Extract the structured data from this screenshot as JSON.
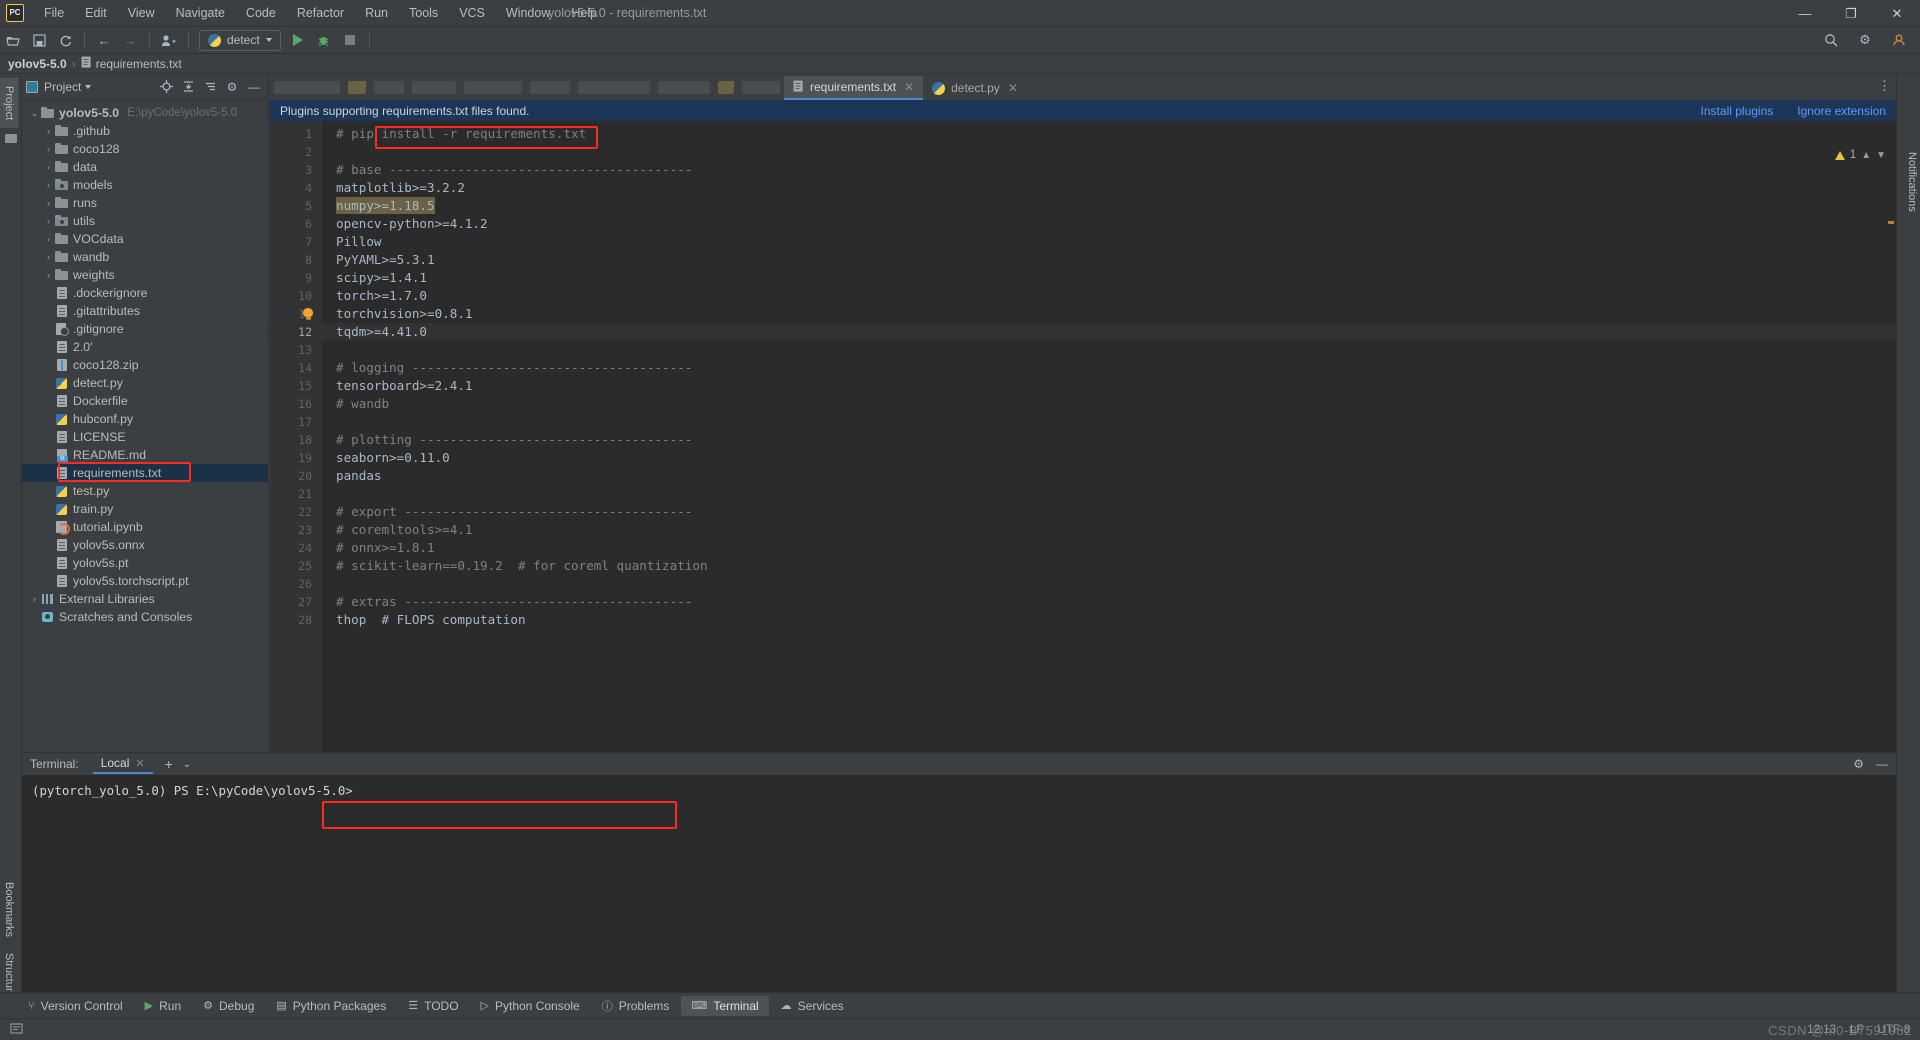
{
  "window": {
    "title": "yolov5-5.0 - requirements.txt",
    "logo": "PC",
    "minimize": "—",
    "maximize": "❐",
    "close": "✕"
  },
  "menu": [
    "File",
    "Edit",
    "View",
    "Navigate",
    "Code",
    "Refactor",
    "Run",
    "Tools",
    "VCS",
    "Window",
    "Help"
  ],
  "toolbar": {
    "open_icon": "open-folder-icon",
    "save_icon": "save-icon",
    "sync_icon": "sync-icon",
    "back_icon": "←",
    "forward_icon": "→",
    "profile_icon": "user-icon",
    "run_config": "detect",
    "run_icon": "run-icon",
    "debug_icon": "debug-icon",
    "stop_icon": "stop-icon",
    "search_icon": "⚲",
    "settings_icon": "⚙",
    "account_icon": "☲"
  },
  "breadcrumb": {
    "project": "yolov5-5.0",
    "separator": "›",
    "file": "requirements.txt"
  },
  "rails": {
    "left_top": "Project",
    "left_bottom_1": "Bookmarks",
    "left_bottom_2": "Structure",
    "right": "Notifications"
  },
  "project_panel": {
    "title": "Project",
    "icons": [
      "locate-icon",
      "collapse-all-icon",
      "expand-icon",
      "gear-icon",
      "hide-icon"
    ],
    "tree": [
      {
        "indent": 0,
        "arrow": "⌄",
        "icon": "folder",
        "name": "yolov5-5.0",
        "path": "E:\\pyCode\\yolov5-5.0",
        "bold": true
      },
      {
        "indent": 1,
        "arrow": "›",
        "icon": "folder",
        "name": ".github"
      },
      {
        "indent": 1,
        "arrow": "›",
        "icon": "folder",
        "name": "coco128"
      },
      {
        "indent": 1,
        "arrow": "›",
        "icon": "folder",
        "name": "data"
      },
      {
        "indent": 1,
        "arrow": "›",
        "icon": "folder-src",
        "name": "models"
      },
      {
        "indent": 1,
        "arrow": "›",
        "icon": "folder",
        "name": "runs"
      },
      {
        "indent": 1,
        "arrow": "›",
        "icon": "folder-src",
        "name": "utils"
      },
      {
        "indent": 1,
        "arrow": "›",
        "icon": "folder",
        "name": "VOCdata"
      },
      {
        "indent": 1,
        "arrow": "›",
        "icon": "folder",
        "name": "wandb"
      },
      {
        "indent": 1,
        "arrow": "›",
        "icon": "folder",
        "name": "weights"
      },
      {
        "indent": 1,
        "arrow": "",
        "icon": "file",
        "name": ".dockerignore"
      },
      {
        "indent": 1,
        "arrow": "",
        "icon": "file",
        "name": ".gitattributes"
      },
      {
        "indent": 1,
        "arrow": "",
        "icon": "git",
        "name": ".gitignore"
      },
      {
        "indent": 1,
        "arrow": "",
        "icon": "file",
        "name": "2.0'"
      },
      {
        "indent": 1,
        "arrow": "",
        "icon": "zip",
        "name": "coco128.zip"
      },
      {
        "indent": 1,
        "arrow": "",
        "icon": "py",
        "name": "detect.py"
      },
      {
        "indent": 1,
        "arrow": "",
        "icon": "file",
        "name": "Dockerfile"
      },
      {
        "indent": 1,
        "arrow": "",
        "icon": "py",
        "name": "hubconf.py"
      },
      {
        "indent": 1,
        "arrow": "",
        "icon": "file",
        "name": "LICENSE"
      },
      {
        "indent": 1,
        "arrow": "",
        "icon": "md",
        "name": "README.md"
      },
      {
        "indent": 1,
        "arrow": "",
        "icon": "file",
        "name": "requirements.txt",
        "selected": true,
        "annotated": true
      },
      {
        "indent": 1,
        "arrow": "",
        "icon": "py",
        "name": "test.py"
      },
      {
        "indent": 1,
        "arrow": "",
        "icon": "py",
        "name": "train.py"
      },
      {
        "indent": 1,
        "arrow": "",
        "icon": "ipynb",
        "name": "tutorial.ipynb"
      },
      {
        "indent": 1,
        "arrow": "",
        "icon": "file",
        "name": "yolov5s.onnx"
      },
      {
        "indent": 1,
        "arrow": "",
        "icon": "file",
        "name": "yolov5s.pt"
      },
      {
        "indent": 1,
        "arrow": "",
        "icon": "file",
        "name": "yolov5s.torchscript.pt"
      },
      {
        "indent": 0,
        "arrow": "›",
        "icon": "lib",
        "name": "External Libraries"
      },
      {
        "indent": 0,
        "arrow": "",
        "icon": "scratch",
        "name": "Scratches and Consoles"
      }
    ]
  },
  "editor": {
    "tabs": [
      {
        "label": "requirements.txt",
        "icon": "txt-file-icon",
        "active": true,
        "close": "✕"
      },
      {
        "label": "detect.py",
        "icon": "python-file-icon",
        "active": false,
        "close": "✕"
      }
    ],
    "notification": {
      "message": "Plugins supporting requirements.txt files found.",
      "action_install": "Install plugins",
      "action_ignore": "Ignore extension"
    },
    "warning_count": "1",
    "lines": [
      {
        "n": 1,
        "text": "# pip install -r requirements.txt",
        "type": "comment",
        "annotated": true
      },
      {
        "n": 2,
        "text": ""
      },
      {
        "n": 3,
        "text": "# base ----------------------------------------",
        "type": "comment"
      },
      {
        "n": 4,
        "text": "matplotlib>=3.2.2"
      },
      {
        "n": 5,
        "text": "numpy>=1.18.5",
        "highlight": true
      },
      {
        "n": 6,
        "text": "opencv-python>=4.1.2"
      },
      {
        "n": 7,
        "text": "Pillow"
      },
      {
        "n": 8,
        "text": "PyYAML>=5.3.1"
      },
      {
        "n": 9,
        "text": "scipy>=1.4.1"
      },
      {
        "n": 10,
        "text": "torch>=1.7.0"
      },
      {
        "n": 11,
        "text": "torchvision>=0.8.1",
        "bulb": true
      },
      {
        "n": 12,
        "text": "tqdm>=4.41.0",
        "current": true
      },
      {
        "n": 13,
        "text": ""
      },
      {
        "n": 14,
        "text": "# logging -------------------------------------",
        "type": "comment"
      },
      {
        "n": 15,
        "text": "tensorboard>=2.4.1"
      },
      {
        "n": 16,
        "text": "# wandb",
        "type": "comment"
      },
      {
        "n": 17,
        "text": ""
      },
      {
        "n": 18,
        "text": "# plotting ------------------------------------",
        "type": "comment"
      },
      {
        "n": 19,
        "text": "seaborn>=0.11.0"
      },
      {
        "n": 20,
        "text": "pandas"
      },
      {
        "n": 21,
        "text": ""
      },
      {
        "n": 22,
        "text": "# export --------------------------------------",
        "type": "comment"
      },
      {
        "n": 23,
        "text": "# coremltools>=4.1",
        "type": "comment"
      },
      {
        "n": 24,
        "text": "# onnx>=1.8.1",
        "type": "comment"
      },
      {
        "n": 25,
        "text": "# scikit-learn==0.19.2  # for coreml quantization",
        "type": "comment"
      },
      {
        "n": 26,
        "text": ""
      },
      {
        "n": 27,
        "text": "# extras --------------------------------------",
        "type": "comment"
      },
      {
        "n": 28,
        "text": "thop  # FLOPS computation"
      }
    ]
  },
  "terminal": {
    "title": "Terminal:",
    "tab": "Local",
    "tab_close": "✕",
    "add": "+",
    "dropdown": "⌄",
    "settings_icon": "⚙",
    "minimize_icon": "—",
    "prompt": "(pytorch_yolo_5.0) PS E:\\pyCode\\yolov5-5.0>"
  },
  "bottom_bar": [
    {
      "label": "Version Control",
      "icon": "branch-icon",
      "active": false
    },
    {
      "label": "Run",
      "icon": "run-icon",
      "active": false
    },
    {
      "label": "Debug",
      "icon": "debug-icon",
      "active": false
    },
    {
      "label": "Python Packages",
      "icon": "package-icon",
      "active": false
    },
    {
      "label": "TODO",
      "icon": "todo-icon",
      "active": false
    },
    {
      "label": "Python Console",
      "icon": "console-icon",
      "active": false
    },
    {
      "label": "Problems",
      "icon": "problems-icon",
      "active": false
    },
    {
      "label": "Terminal",
      "icon": "terminal-icon",
      "active": true
    },
    {
      "label": "Services",
      "icon": "services-icon",
      "active": false
    }
  ],
  "status_bar": {
    "position": "12:13",
    "line_separator": "LF",
    "encoding": "UTF-8",
    "watermark": "CSDN @m0-B7591982"
  },
  "colors": {
    "accent_blue": "#4a88c7",
    "annotation_red": "#ff2a1f",
    "notification_bg": "#1d3557",
    "link_blue": "#589df6",
    "selection_bg": "#1b3147",
    "editor_bg": "#2b2b2b",
    "panel_bg": "#3c3f41",
    "highlight_bg": "#6b6144"
  }
}
